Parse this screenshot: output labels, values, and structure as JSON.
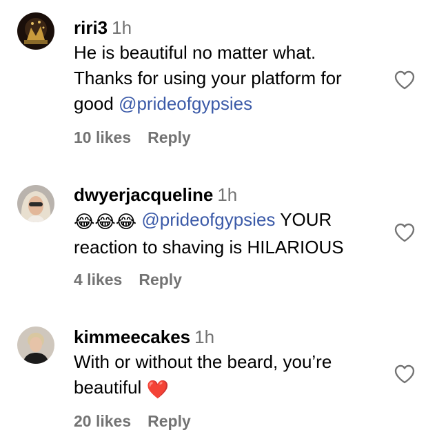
{
  "colors": {
    "mention": "#3b5aa8",
    "secondary_text": "#737373",
    "heart_emoji": "#e0245e"
  },
  "comments": [
    {
      "username": "riri3",
      "time": "1h",
      "text_line1": "He is beautiful no matter what.",
      "text_line2": "Thanks for using your platform for",
      "text_line3_prefix": "good",
      "mention": "@prideofgypsies",
      "likes": "10 likes",
      "reply_label": "Reply",
      "like_icon": "heart-outline-icon"
    },
    {
      "username": "dwyerjacqueline",
      "time": "1h",
      "emoji": "😂😂😂",
      "mention": "@prideofgypsies",
      "text_after_mention": "YOUR",
      "text_line2": "reaction to shaving is HILARIOUS",
      "likes": "4 likes",
      "reply_label": "Reply",
      "like_icon": "heart-outline-icon"
    },
    {
      "username": "kimmeecakes",
      "time": "1h",
      "text_line1": "With or without the beard, you’re",
      "text_line2": "beautiful",
      "emoji": "❤️",
      "likes": "20 likes",
      "reply_label": "Reply",
      "like_icon": "heart-outline-icon"
    }
  ]
}
